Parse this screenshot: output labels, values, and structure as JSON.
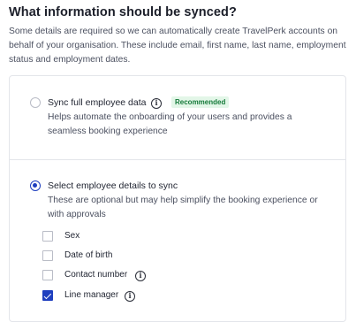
{
  "section": {
    "title": "What information should be synced?",
    "description": "Some details are required so we can automatically create TravelPerk accounts on behalf of your organisation. These include email, first name, last name, employment status and employment dates."
  },
  "options": {
    "full": {
      "label": "Sync full employee data",
      "badge": "Recommended",
      "help": "Helps automate the onboarding of your users and provides a seamless booking experience",
      "selected": false
    },
    "select": {
      "label": "Select employee details to sync",
      "help": "These are optional but may help simplify the booking experience or with approvals",
      "selected": true
    }
  },
  "details": [
    {
      "label": "Sex",
      "checked": false,
      "info": false
    },
    {
      "label": "Date of birth",
      "checked": false,
      "info": false
    },
    {
      "label": "Contact number",
      "checked": false,
      "info": true
    },
    {
      "label": "Line manager",
      "checked": true,
      "info": true
    }
  ],
  "icons": {
    "info": "info-circle-icon",
    "info_glyph": "i"
  },
  "colors": {
    "accent": "#1f3fbf",
    "badge_bg": "#e3f6e8",
    "badge_text": "#157a3a",
    "border": "#e3e5ea"
  }
}
